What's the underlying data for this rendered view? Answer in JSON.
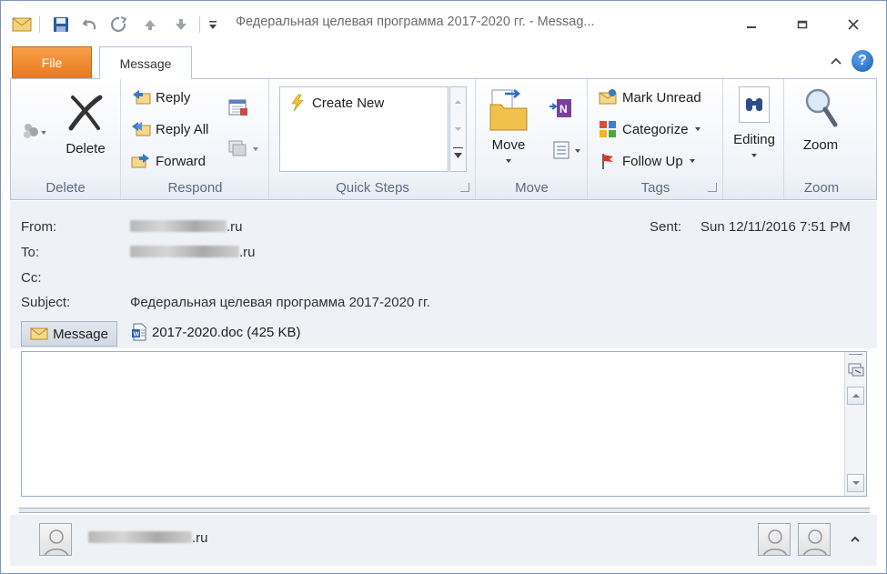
{
  "window": {
    "title": "Федеральная целевая программа 2017-2020 гг.  -  Messag...",
    "quick_access": [
      "mail-icon",
      "save-icon",
      "undo-icon",
      "redo-icon",
      "previous-item-icon",
      "next-item-icon",
      "customize-qat-icon"
    ]
  },
  "tabs": {
    "file": "File",
    "message": "Message"
  },
  "ribbon": {
    "delete_group": {
      "label": "Delete",
      "delete_button": "Delete"
    },
    "respond_group": {
      "label": "Respond",
      "reply": "Reply",
      "reply_all": "Reply All",
      "forward": "Forward"
    },
    "quick_steps_group": {
      "label": "Quick Steps",
      "create_new": "Create New"
    },
    "move_group": {
      "label": "Move",
      "move_button": "Move"
    },
    "tags_group": {
      "label": "Tags",
      "mark_unread": "Mark Unread",
      "categorize": "Categorize",
      "follow_up": "Follow Up"
    },
    "editing_group": {
      "editing_button": "Editing"
    },
    "zoom_group": {
      "label": "Zoom",
      "zoom_button": "Zoom"
    }
  },
  "header": {
    "from_label": "From:",
    "from_value": ".ru",
    "to_label": "To:",
    "to_value": ".ru",
    "cc_label": "Cc:",
    "subject_label": "Subject:",
    "subject_value": "Федеральная целевая программа 2017-2020 гг.",
    "sent_label": "Sent:",
    "sent_value": "Sun 12/11/2016 7:51 PM"
  },
  "attachments": {
    "message_tab": "Message",
    "items": [
      {
        "name": "2017-2020.doc (425 KB)"
      }
    ]
  },
  "people_pane": {
    "sender": ".ru"
  },
  "colors": {
    "file_tab": "#e9791e",
    "accent_blue": "#1c5fb0"
  }
}
